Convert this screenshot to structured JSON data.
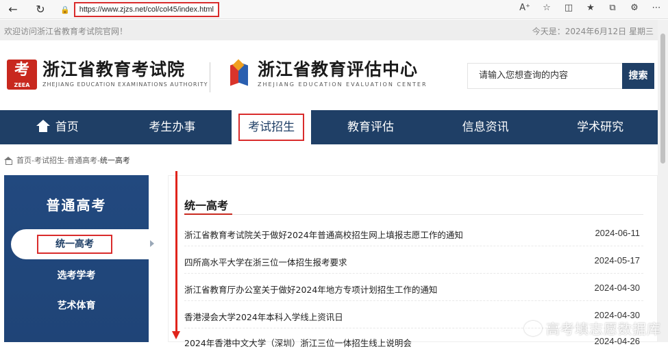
{
  "browser": {
    "url": "https://www.zjzs.net/col/col45/index.html",
    "back_icon": "back-arrow-icon",
    "refresh_icon": "refresh-icon"
  },
  "top_strip": {
    "welcome": "欢迎访问浙江省教育考试院官网！",
    "today": "今天是：2024年6月12日 星期三"
  },
  "header": {
    "logo1_mark": "考",
    "logo1_mark_sub": "ZEEA",
    "logo1_cn": "浙江省教育考试院",
    "logo1_en": "ZHEJIANG EDUCATION EXAMINATIONS AUTHORITY",
    "logo2_cn": "浙江省教育评估中心",
    "logo2_en": "ZHEJIANG EDUCATION EVALUATION CENTER",
    "search_placeholder": "请输入您想查询的内容",
    "search_button": "搜索"
  },
  "nav": {
    "items": [
      "首页",
      "考生办事",
      "考试招生",
      "教育评估",
      "信息资讯",
      "学术研究"
    ],
    "active_index": 2
  },
  "breadcrumb": {
    "path": "首页-考试招生-普通高考-",
    "current": "统一高考"
  },
  "sidebar": {
    "title": "普通高考",
    "items": [
      "统一高考",
      "选考学考",
      "艺术体育"
    ]
  },
  "content": {
    "title": "统一高考",
    "news": [
      {
        "title": "浙江省教育考试院关于做好2024年普通高校招生网上填报志愿工作的通知",
        "date": "2024-06-11"
      },
      {
        "title": "四所高水平大学在浙三位一体招生报考要求",
        "date": "2024-05-17"
      },
      {
        "title": "浙江省教育厅办公室关于做好2024年地方专项计划招生工作的通知",
        "date": "2024-04-30"
      },
      {
        "title": "香港浸会大学2024年本科入学线上资讯日",
        "date": "2024-04-30"
      },
      {
        "title": "2024年香港中文大学（深圳）浙江三位一体招生线上说明会",
        "date": "2024-04-26"
      }
    ]
  },
  "watermark": "高考填志愿数据库",
  "colors": {
    "nav_bg": "#1f3f66",
    "highlight_red": "#d92b2b",
    "sidebar_bg": "#22497f"
  }
}
